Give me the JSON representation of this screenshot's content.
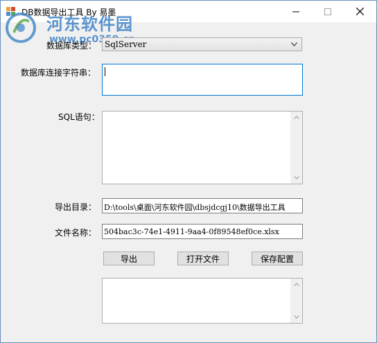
{
  "window": {
    "title": "DB数据导出工具 By 易墨"
  },
  "watermark": {
    "title": "河东软件园",
    "url": "www.pc0359.cn"
  },
  "form": {
    "db_type_label": "数据库类型：",
    "db_type_value": "SqlServer",
    "conn_label": "数据库连接字符串：",
    "conn_value": "",
    "sql_label": "SQL语句：",
    "sql_value": "",
    "dir_label": "导出目录：",
    "dir_value": "D:\\tools\\桌面\\河东软件园\\dbsjdcgj10\\数据导出工具",
    "file_label": "文件名称：",
    "file_value": "504bac3c-74e1-4911-9aa4-0f89548ef0ce.xlsx",
    "log_value": ""
  },
  "buttons": {
    "export": "导出",
    "open_file": "打开文件",
    "save_config": "保存配置"
  },
  "colors": {
    "focus_border": "#0078d7",
    "watermark": "#3f83c6"
  },
  "icons": [
    "app-icon",
    "minimize-icon",
    "maximize-icon",
    "close-icon",
    "dropdown-arrow-icon",
    "scroll-up-icon",
    "scroll-down-icon"
  ]
}
